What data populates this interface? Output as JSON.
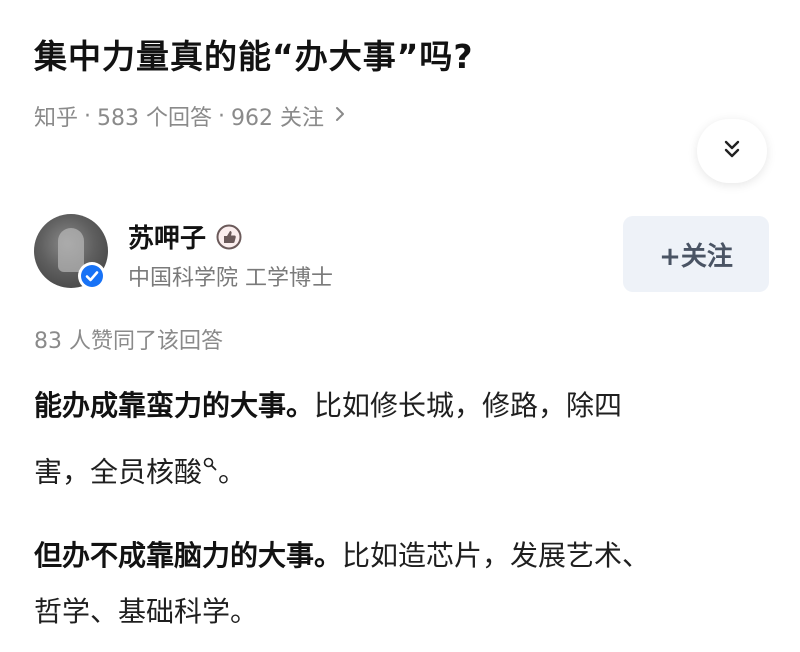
{
  "question": {
    "title": "集中力量真的能“办大事”吗?",
    "source": "知乎",
    "answer_count": "583 个回答",
    "follower_count": "962 关注",
    "separator": "·"
  },
  "author": {
    "name": "苏呷子",
    "bio": "中国科学院 工学博士",
    "follow_label": "+关注"
  },
  "answer": {
    "vote_text": "83 人赞同了该回答",
    "para1_bold": "能办成靠蛮力的大事。",
    "para1_line1_rest": "比如修长城，修路，除四",
    "para1_line2": "害，全员核酸",
    "para1_end": "。",
    "para2_bold": "但办不成靠脑力的大事。",
    "para2_line1_rest": "比如造芯片，发展艺术、",
    "para2_line2": "哲学、基础科学。"
  },
  "icons": {
    "expand": "double-chevron-down-icon",
    "verified": "verified-check-icon",
    "medal": "thumb-medal-icon",
    "search": "search-icon",
    "meta_chevron": "chevron-right-icon"
  },
  "colors": {
    "verified_blue": "#1772f6",
    "meta_gray": "#8a8a8a",
    "follow_bg": "#eef2f8"
  }
}
